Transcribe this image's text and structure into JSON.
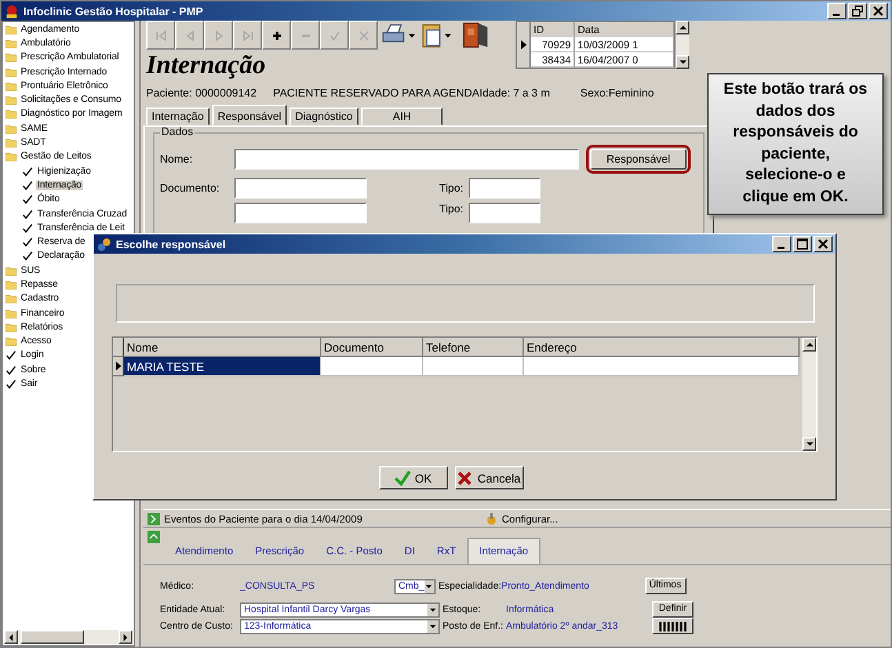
{
  "window": {
    "title": "Infoclinic Gestão Hospitalar - PMP"
  },
  "sidebar": {
    "items": [
      {
        "label": "Agendamento",
        "kind": "folder",
        "selected": false
      },
      {
        "label": "Ambulatório",
        "kind": "folder",
        "selected": false
      },
      {
        "label": "Prescrição Ambulatorial",
        "kind": "folder",
        "selected": false
      },
      {
        "label": "Prescrição Internado",
        "kind": "folder",
        "selected": false
      },
      {
        "label": "Prontuário Eletrônico",
        "kind": "folder",
        "selected": false
      },
      {
        "label": "Solicitações e Consumo",
        "kind": "folder",
        "selected": false
      },
      {
        "label": "Diagnóstico por Imagem",
        "kind": "folder",
        "selected": false
      },
      {
        "label": "SAME",
        "kind": "folder",
        "selected": false
      },
      {
        "label": "SADT",
        "kind": "folder",
        "selected": false
      },
      {
        "label": "Gestão de Leitos",
        "kind": "folder",
        "selected": false,
        "children": [
          {
            "label": "Higienização",
            "kind": "check",
            "selected": false
          },
          {
            "label": "Internação",
            "kind": "check",
            "selected": true
          },
          {
            "label": "Óbito",
            "kind": "check",
            "selected": false
          },
          {
            "label": "Transferência Cruzad",
            "kind": "check",
            "selected": false
          },
          {
            "label": "Transferência de Leit",
            "kind": "check",
            "selected": false
          },
          {
            "label": "Reserva de",
            "kind": "check",
            "selected": false
          },
          {
            "label": "Declaração",
            "kind": "check",
            "selected": false
          }
        ]
      },
      {
        "label": "SUS",
        "kind": "folder",
        "selected": false
      },
      {
        "label": "Repasse",
        "kind": "folder",
        "selected": false
      },
      {
        "label": "Cadastro",
        "kind": "folder",
        "selected": false
      },
      {
        "label": "Financeiro",
        "kind": "folder",
        "selected": false
      },
      {
        "label": "Relatórios",
        "kind": "folder",
        "selected": false
      },
      {
        "label": "Acesso",
        "kind": "folder",
        "selected": false
      },
      {
        "label": "Login",
        "kind": "check",
        "selected": false
      },
      {
        "label": "Sobre",
        "kind": "check",
        "selected": false
      },
      {
        "label": "Sair",
        "kind": "check",
        "selected": false
      }
    ]
  },
  "record_grid": {
    "columns": [
      "ID",
      "Data"
    ],
    "rows": [
      {
        "id": "70929",
        "date": "10/03/2009 1",
        "selected": true
      },
      {
        "id": "38434",
        "date": "16/04/2007 0",
        "selected": false
      }
    ]
  },
  "page_title": "Internação",
  "patient": {
    "id": "Paciente: 0000009142",
    "status": "PACIENTE RESERVADO PARA AGENDA",
    "age": "Idade: 7 a 3 m",
    "sex": "Sexo:Feminino"
  },
  "tabs": [
    {
      "label": "Internação",
      "selected": false
    },
    {
      "label": "Responsável",
      "selected": true
    },
    {
      "label": "Diagnóstico",
      "selected": false
    },
    {
      "label": "AIH",
      "selected": false
    }
  ],
  "group": {
    "title": "Dados",
    "name_label": "Nome:",
    "document_label": "Documento:",
    "type_labels": [
      "Tipo:",
      "Tipo:"
    ],
    "button": {
      "label": "Responsável",
      "highlighted": true
    }
  },
  "callout": "Este botão trará os dados dos responsáveis do paciente, selecione-o e clique em OK.",
  "dialog": {
    "title": "Escolhe responsável",
    "columns": [
      "Nome",
      "Documento",
      "Telefone",
      "Endereço"
    ],
    "rows": [
      {
        "name": "MARIA TESTE",
        "selected": true
      }
    ],
    "buttons": [
      {
        "label": "OK",
        "kind": "ok"
      },
      {
        "label": "Cancela",
        "kind": "cancel"
      }
    ]
  },
  "events_bar": {
    "label": "Eventos do Paciente para o dia 14/04/2009",
    "configure": "Configurar..."
  },
  "bottom_tabs": [
    {
      "label": "Atendimento",
      "selected": false
    },
    {
      "label": "Prescrição",
      "selected": false
    },
    {
      "label": "C.C. - Posto",
      "selected": false
    },
    {
      "label": "DI",
      "selected": false
    },
    {
      "label": "RxT",
      "selected": false
    },
    {
      "label": "Internação",
      "selected": true
    }
  ],
  "form": {
    "doctor_label": "Médico:",
    "doctor": "_CONSULTA_PS",
    "combo": "Cmb_",
    "specialty_label": "Especialidade:",
    "specialty": "Pronto_Atendimento",
    "last_button": "Últimos",
    "entity_label": "Entidade Atual:",
    "entity": "Hospital Infantil Darcy Vargas",
    "stock_label": "Estoque:",
    "stock": "Informática",
    "define_button": "Definir",
    "cost_label": "Centro de Custo:",
    "cost": "123-Informática",
    "post_label": "Posto de Enf.:",
    "post": "Ambulatório 2º andar_313"
  }
}
